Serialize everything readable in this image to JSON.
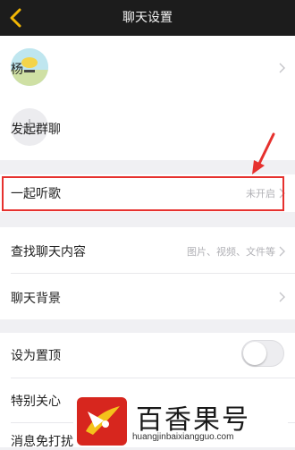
{
  "header": {
    "title": "聊天设置",
    "back_icon": "back-arrow-icon"
  },
  "contact": {
    "name": "杨",
    "action": "发起群聊"
  },
  "listen_together": {
    "label": "一起听歌",
    "value": "未开启"
  },
  "find_content": {
    "label": "查找聊天内容",
    "hint": "图片、视频、文件等"
  },
  "chat_background": {
    "label": "聊天背景"
  },
  "pin_top": {
    "label": "设为置顶",
    "enabled": false
  },
  "special_care": {
    "label": "特别关心"
  },
  "next_item": {
    "label": "消息免打扰"
  },
  "watermark": {
    "name": "百香果号",
    "url": "huangjinbaixiangguo.com"
  },
  "colors": {
    "accent": "#f2b705",
    "highlight": "#e6312e",
    "header_bg": "#1c1c1c"
  }
}
